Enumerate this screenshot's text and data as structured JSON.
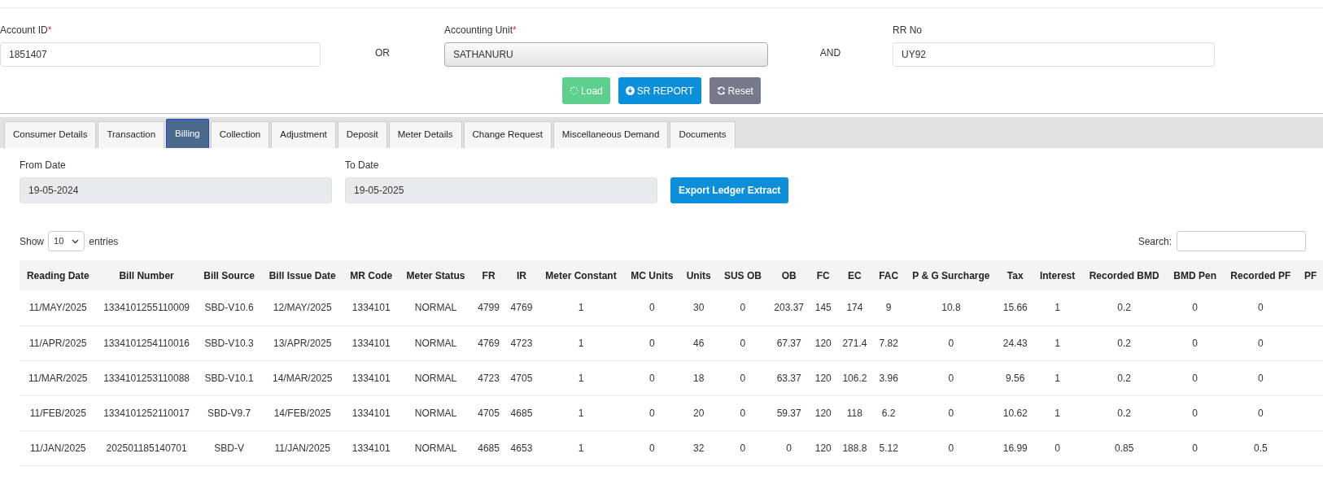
{
  "search_form": {
    "fields": [
      {
        "kind": "input",
        "label": "Account ID",
        "required_mark": "*",
        "value": "1851407"
      },
      {
        "kind": "connector",
        "text": "OR"
      },
      {
        "kind": "select",
        "label": "Accounting Unit",
        "required_mark": "*",
        "value": "SATHANURU"
      },
      {
        "kind": "connector",
        "text": "AND"
      },
      {
        "kind": "input",
        "label": "RR No",
        "value": "UY92"
      }
    ],
    "buttons": [
      {
        "kind": "load",
        "label": "Load",
        "disabled": true
      },
      {
        "kind": "report",
        "label": "SR REPORT",
        "disabled": false
      },
      {
        "kind": "reset",
        "label": "Reset",
        "disabled": false
      }
    ]
  },
  "tabs": [
    {
      "label": "Consumer Details",
      "selected": false
    },
    {
      "label": "Transaction",
      "selected": false
    },
    {
      "label": "Billing",
      "selected": true
    },
    {
      "label": "Collection",
      "selected": false
    },
    {
      "label": "Adjustment",
      "selected": false
    },
    {
      "label": "Deposit",
      "selected": false
    },
    {
      "label": "Meter Details",
      "selected": false
    },
    {
      "label": "Change Request",
      "selected": false
    },
    {
      "label": "Miscellaneous Demand",
      "selected": false
    },
    {
      "label": "Documents",
      "selected": false
    }
  ],
  "date_filter": {
    "from": {
      "label": "From Date",
      "value": "19-05-2024"
    },
    "to": {
      "label": "To Date",
      "value": "19-05-2025"
    },
    "export_button": "Export Ledger Extract"
  },
  "table_controls": {
    "show_label": "Show",
    "page_size": "10",
    "entries_label": "entries",
    "search_label": "Search:"
  },
  "table": {
    "columns": [
      "Reading Date",
      "Bill Number",
      "Bill Source",
      "Bill Issue Date",
      "MR Code",
      "Meter Status",
      "FR",
      "IR",
      "Meter Constant",
      "MC Units",
      "Units",
      "SUS OB",
      "OB",
      "FC",
      "EC",
      "FAC",
      "P & G Surcharge",
      "Tax",
      "Interest",
      "Recorded BMD",
      "BMD Pen",
      "Recorded PF",
      "PF"
    ],
    "rows": [
      [
        "11/MAY/2025",
        "1334101255110009",
        "SBD-V10.6",
        "12/MAY/2025",
        "1334101",
        "NORMAL",
        "4799",
        "4769",
        "1",
        "0",
        "30",
        "0",
        "203.37",
        "145",
        "174",
        "9",
        "10.8",
        "15.66",
        "1",
        "0.2",
        "0",
        "0",
        ""
      ],
      [
        "11/APR/2025",
        "1334101254110016",
        "SBD-V10.3",
        "13/APR/2025",
        "1334101",
        "NORMAL",
        "4769",
        "4723",
        "1",
        "0",
        "46",
        "0",
        "67.37",
        "120",
        "271.4",
        "7.82",
        "0",
        "24.43",
        "1",
        "0.2",
        "0",
        "0",
        ""
      ],
      [
        "11/MAR/2025",
        "1334101253110088",
        "SBD-V10.1",
        "14/MAR/2025",
        "1334101",
        "NORMAL",
        "4723",
        "4705",
        "1",
        "0",
        "18",
        "0",
        "63.37",
        "120",
        "106.2",
        "3.96",
        "0",
        "9.56",
        "1",
        "0.2",
        "0",
        "0",
        ""
      ],
      [
        "11/FEB/2025",
        "1334101252110017",
        "SBD-V9.7",
        "14/FEB/2025",
        "1334101",
        "NORMAL",
        "4705",
        "4685",
        "1",
        "0",
        "20",
        "0",
        "59.37",
        "120",
        "118",
        "6.2",
        "0",
        "10.62",
        "1",
        "0.2",
        "0",
        "0",
        ""
      ],
      [
        "11/JAN/2025",
        "202501185140701",
        "SBD-V",
        "11/JAN/2025",
        "1334101",
        "NORMAL",
        "4685",
        "4653",
        "1",
        "0",
        "32",
        "0",
        "0",
        "120",
        "188.8",
        "5.12",
        "0",
        "16.99",
        "0",
        "0.85",
        "0",
        "0.5",
        ""
      ]
    ]
  }
}
